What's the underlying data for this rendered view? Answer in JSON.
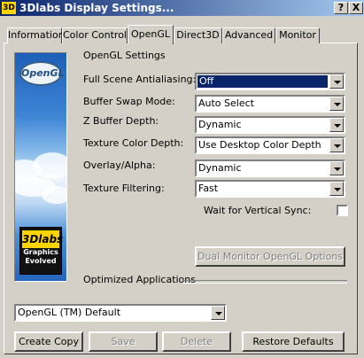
{
  "window": {
    "logo_text": "3D",
    "title": "3Dlabs Display Settings...",
    "help_glyph": "?",
    "close_glyph": "X"
  },
  "tabs": [
    {
      "label": "Information"
    },
    {
      "label": "Color Control"
    },
    {
      "label": "OpenGL"
    },
    {
      "label": "Direct3D"
    },
    {
      "label": "Advanced"
    },
    {
      "label": "Monitor"
    }
  ],
  "active_tab": "OpenGL",
  "banner": {
    "opengl_logo": "OpenGL",
    "brand_logo": "3Dlabs",
    "brand_tagline_1": "Graphics",
    "brand_tagline_2": "Evolved"
  },
  "settings": {
    "heading": "OpenGL Settings",
    "fields": [
      {
        "label": "Full Scene Antialiasing:",
        "value": "Off"
      },
      {
        "label": "Buffer Swap Mode:",
        "value": "Auto Select"
      },
      {
        "label": "Z Buffer Depth:",
        "value": "Dynamic"
      },
      {
        "label": "Texture Color Depth:",
        "value": "Use Desktop Color Depth"
      },
      {
        "label": "Overlay/Alpha:",
        "value": "Dynamic"
      },
      {
        "label": "Texture Filtering:",
        "value": "Fast"
      }
    ],
    "vsync_label": "Wait for Vertical Sync:",
    "vsync_checked": false,
    "dual_monitor_button": "Dual Monitor OpenGL Options"
  },
  "optimized": {
    "heading": "Optimized Applications",
    "selected": "OpenGL (TM) Default"
  },
  "buttons": {
    "create_copy": "Create Copy",
    "save": "Save",
    "delete": "Delete",
    "restore": "Restore Defaults"
  }
}
